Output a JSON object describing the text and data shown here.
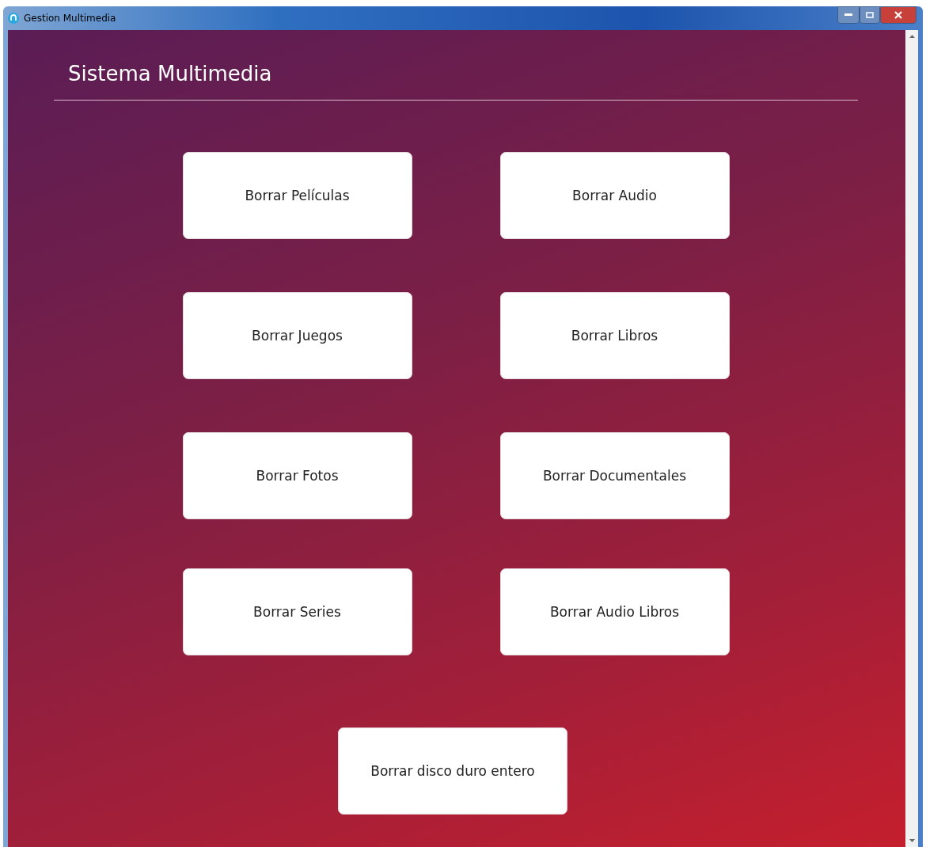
{
  "window": {
    "title": "Gestion Multimedia"
  },
  "heading": "Sistema Multimedia",
  "buttons": [
    {
      "label": "Borrar Películas"
    },
    {
      "label": "Borrar Audio"
    },
    {
      "label": "Borrar Juegos"
    },
    {
      "label": "Borrar Libros"
    },
    {
      "label": "Borrar Fotos"
    },
    {
      "label": "Borrar Documentales"
    },
    {
      "label": "Borrar Series"
    },
    {
      "label": "Borrar Audio Libros"
    }
  ],
  "main_button": {
    "label": "Borrar disco duro entero"
  }
}
